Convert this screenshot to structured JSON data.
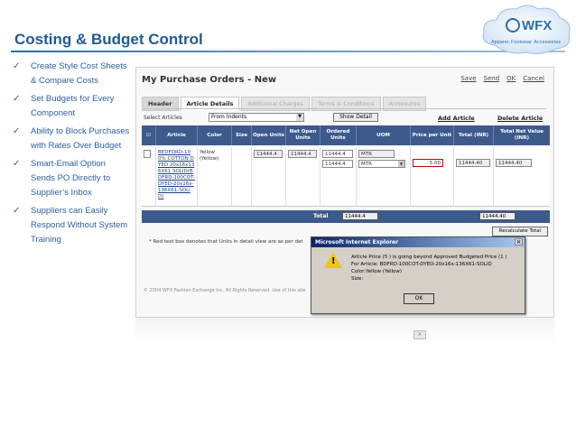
{
  "slide": {
    "title": "Costing & Budget Control",
    "logo": {
      "brand": "WFX",
      "tagline": "Apparel. Footwear. Accessories"
    },
    "bullets": [
      "Create Style Cost Sheets & Compare Costs",
      "Set Budgets for Every Component",
      "Ability to Block Purchases with Rates Over Budget",
      "Smart-Email Option Sends PO Directly to Supplier’s Inbox",
      "Suppliers can Easily Respond Without System Training"
    ]
  },
  "screenshot": {
    "title": "My Purchase Orders - New",
    "links": [
      "Save",
      "Send",
      "OK",
      "Cancel"
    ],
    "tabs": [
      "Header",
      "Article Details",
      "Additional Charges",
      "Terms & Conditions",
      "Annexures"
    ],
    "select_label": "Select Articles",
    "select_value": "From Indents",
    "show_detail": "Show Detail",
    "add_article": "Add Article",
    "delete_article": "Delete Article",
    "columns": [
      "Article",
      "Color",
      "Size",
      "Open Units",
      "Net Open Units",
      "Ordered Units",
      "UOM",
      "Price per Unit",
      "Total (INR)",
      "Total Net Value (INR)"
    ],
    "row": {
      "article": "BEDFORD-100% COTTON DYED 20x16x136X61 SOLID(BDFRD-100COT-DYED-20x16x-136X61-SOLID)",
      "color": "Yellow (Yellow)",
      "open_units": "11444.4",
      "net_open_units": "11444.4",
      "ordered_units_1": "11444.4",
      "ordered_units_2": "11444.4",
      "uom_1": "MTR",
      "uom_2": "MTR",
      "price": "5.00",
      "total": "11444.40",
      "total_net": "11444.40"
    },
    "total_label": "Total",
    "total_units": "11444.4",
    "total_value": "11444.40",
    "recalc": "Recalculate Total",
    "note": "Red text box denotes that Units in detail view are as per det",
    "copyright": "© 2004 WFX Fashion Exchange Inc. All Rights Reserved. Use of this site",
    "dialog": {
      "title": "Microsoft Internet Explorer",
      "line1": "Article Price (5 ) is going beyond Approved Budgeted Price (1 )",
      "line2": "For Article: BDFRD-100COT-DYED-20x16x-136X61-SOLID",
      "line3": "Color:Yellow (Yellow)",
      "line4": "Size:",
      "ok": "OK"
    },
    "close": "✕"
  }
}
